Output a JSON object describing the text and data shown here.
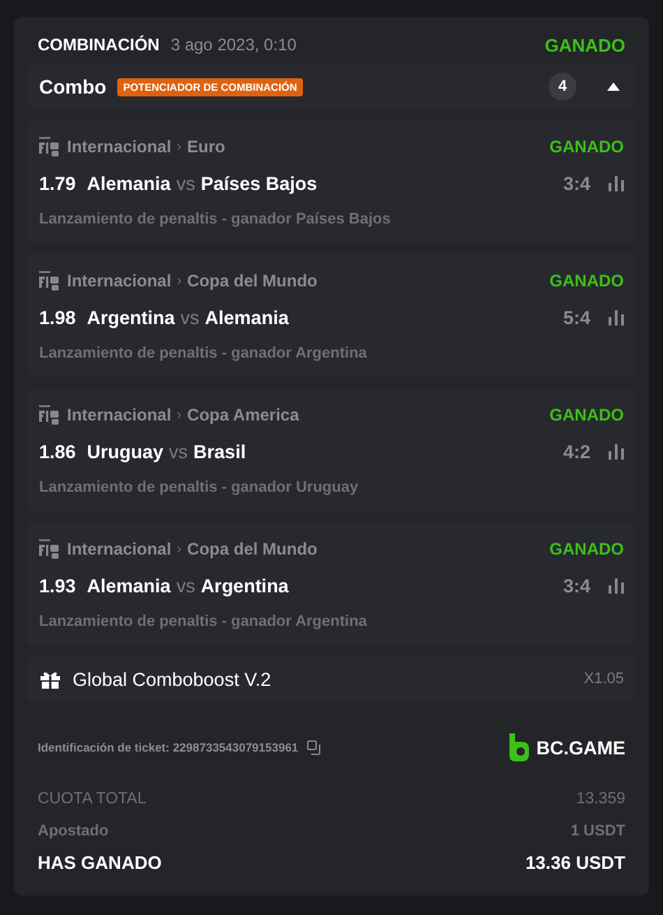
{
  "header": {
    "title": "COMBINACIÓN",
    "date": "3 ago 2023, 0:10",
    "status": "GANADO"
  },
  "combo": {
    "label": "Combo",
    "badge": "POTENCIADOR DE COMBINACIÓN",
    "count": "4",
    "expanded": true
  },
  "matches": [
    {
      "category": "Internacional",
      "separator": "›",
      "league": "Euro",
      "status": "GANADO",
      "odds": "1.79",
      "home": "Alemania",
      "vs": "vs",
      "away": "Países Bajos",
      "score": "3:4",
      "market": "Lanzamiento de penaltis - ganador Países Bajos"
    },
    {
      "category": "Internacional",
      "separator": "›",
      "league": "Copa del Mundo",
      "status": "GANADO",
      "odds": "1.98",
      "home": "Argentina",
      "vs": "vs",
      "away": "Alemania",
      "score": "5:4",
      "market": "Lanzamiento de penaltis - ganador Argentina"
    },
    {
      "category": "Internacional",
      "separator": "›",
      "league": "Copa America",
      "status": "GANADO",
      "odds": "1.86",
      "home": "Uruguay",
      "vs": "vs",
      "away": "Brasil",
      "score": "4:2",
      "market": "Lanzamiento de penaltis - ganador Uruguay"
    },
    {
      "category": "Internacional",
      "separator": "›",
      "league": "Copa del Mundo",
      "status": "GANADO",
      "odds": "1.93",
      "home": "Alemania",
      "vs": "vs",
      "away": "Argentina",
      "score": "3:4",
      "market": "Lanzamiento de penaltis - ganador Argentina"
    }
  ],
  "boost": {
    "label": "Global Comboboost V.2",
    "multiplier": "X1.05"
  },
  "ticket": {
    "label": "Identificación de ticket: 2298733543079153961",
    "brand": "BC.GAME"
  },
  "summary": [
    {
      "kind": "muted",
      "label": "CUOTA TOTAL",
      "value": "13.359"
    },
    {
      "kind": "semi",
      "label": "Apostado",
      "value": "1 USDT"
    },
    {
      "kind": "strong",
      "label": "HAS GANADO",
      "value": "13.36 USDT"
    }
  ]
}
